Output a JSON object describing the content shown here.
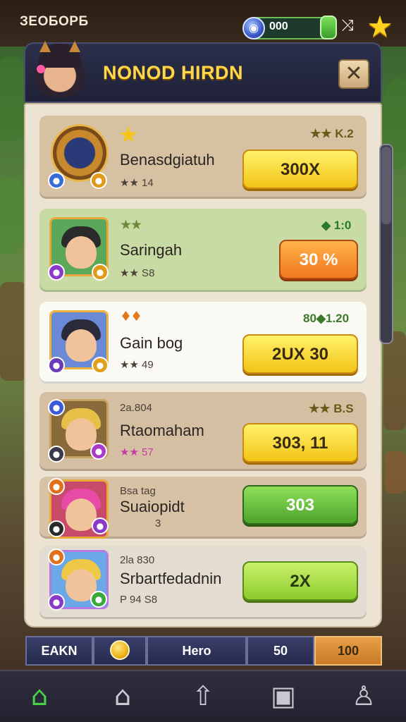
{
  "status_bar": {
    "title": "ЗЕОБОРБ",
    "currency_value": "000",
    "gem_icon": "gem-icon",
    "link_icon": "shuffle-icon",
    "star_icon": "star-icon"
  },
  "panel": {
    "title": "NONOD HIRDN",
    "close_label": "✕"
  },
  "rows": [
    {
      "name": "Benasdgiatuh",
      "tag": "★★ K.2",
      "sub": "★★ 14",
      "top_stars": "★",
      "button": "300X",
      "button_style": "yellow",
      "row_color": "#d6c2a3"
    },
    {
      "name": "Saringah",
      "tag": "◆ 1:0",
      "sub": "★★ S8",
      "top_stars": "★★",
      "button": "30 %",
      "button_style": "orange",
      "row_color": "#c9dba5"
    },
    {
      "name": "Gain bog",
      "tag": "80◆1.20",
      "sub": "★★ 49",
      "top_stars": "♦♦",
      "button": "2UX 30",
      "button_style": "yellow",
      "row_color": "#fbf9f4"
    },
    {
      "name": "Rtaomaham",
      "tag": "★★ B.S",
      "sub": "★★ 57",
      "top_line": "2a.804",
      "button": "303, 11",
      "button_style": "yellow",
      "row_color": "#d4bfa3"
    },
    {
      "name": "Suaiopidt",
      "tag": "",
      "sub": "3",
      "top_line": "Bsa tag",
      "button": "303",
      "button_style": "green",
      "row_color": "#d8c2a6"
    },
    {
      "name": "Srbartfedadnin",
      "tag": "",
      "sub": "P 94 S8",
      "top_line": "2la 830",
      "button": "2X",
      "button_style": "lime",
      "row_color": "#e3ddd1"
    }
  ],
  "stat_strip": {
    "label": "EAKN",
    "coin_icon": "coin-icon",
    "hero": "Hero",
    "value": "50",
    "highlight": "100"
  },
  "nav": {
    "items": [
      {
        "icon": "home-icon",
        "active": true
      },
      {
        "icon": "house-icon",
        "active": false
      },
      {
        "icon": "upgrade-icon",
        "active": false
      },
      {
        "icon": "inventory-icon",
        "active": false
      },
      {
        "icon": "profile-icon",
        "active": false
      }
    ]
  }
}
